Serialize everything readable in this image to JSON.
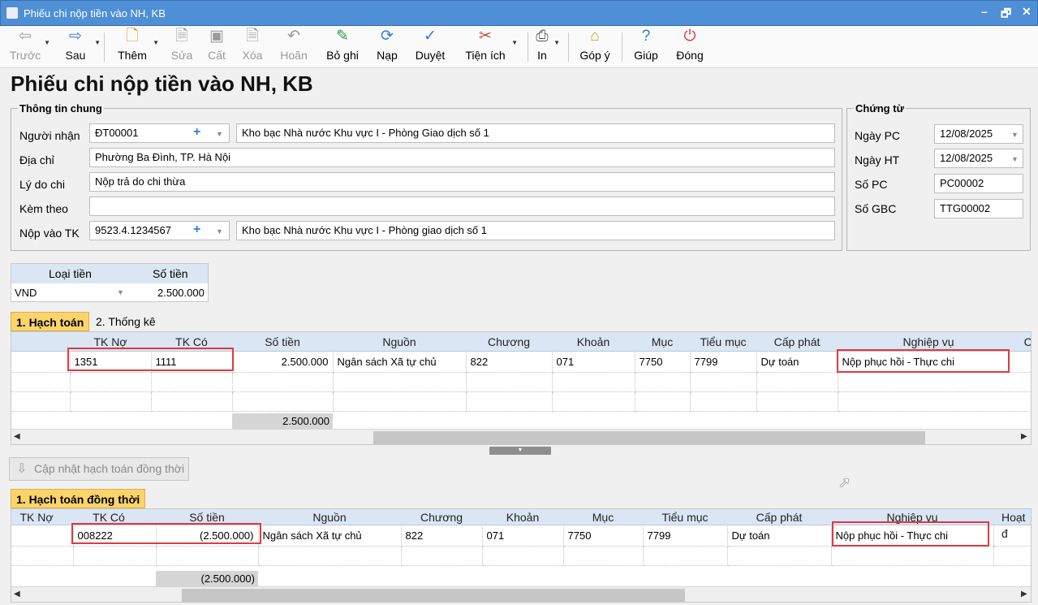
{
  "window": {
    "title": "Phiếu chi nộp tiền vào NH, KB",
    "min": "–",
    "restore": "🗗",
    "close": "✕"
  },
  "toolbar": {
    "prev": "Trước",
    "next": "Sau",
    "add": "Thêm",
    "edit": "Sửa",
    "save": "Cất",
    "delete": "Xóa",
    "undo": "Hoãn",
    "unpost": "Bỏ ghi",
    "reload": "Nạp",
    "approve": "Duyệt",
    "utilities": "Tiện ích",
    "print": "In",
    "feedback": "Góp ý",
    "help": "Giúp",
    "close": "Đóng"
  },
  "page_title": "Phiếu chi nộp tiền vào NH, KB",
  "general": {
    "legend": "Thông tin chung",
    "recipient_label": "Người nhận",
    "recipient_code": "ĐT00001",
    "recipient_name": "Kho bạc Nhà nước Khu vực I - Phòng Giao dịch số 1",
    "address_label": "Địa chỉ",
    "address": "Phường Ba Đình, TP. Hà Nội",
    "reason_label": "Lý do chi",
    "reason": "Nộp trả do chi thừa",
    "attach_label": "Kèm theo",
    "attach": "",
    "account_label": "Nộp vào TK",
    "account_code": "9523.4.1234567",
    "account_name": "Kho bạc Nhà nước Khu vực I - Phòng giao dịch số 1"
  },
  "voucher": {
    "legend": "Chứng từ",
    "date_pc_label": "Ngày PC",
    "date_pc": "12/08/2025",
    "date_ht_label": "Ngày HT",
    "date_ht": "12/08/2025",
    "no_pc_label": "Số PC",
    "no_pc": "PC00002",
    "no_gbc_label": "Số GBC",
    "no_gbc": "TTG00002"
  },
  "currency": {
    "type_header": "Loại tiền",
    "amount_header": "Số tiền",
    "type": "VND",
    "amount": "2.500.000"
  },
  "tabs": {
    "t1": "1. Hạch toán",
    "t2": "2. Thống kê"
  },
  "grid1": {
    "headers": [
      "TK Nợ",
      "TK Có",
      "Số tiền",
      "Nguồn",
      "Chương",
      "Khoản",
      "Mục",
      "Tiểu mục",
      "Cấp phát",
      "Nghiệp vụ",
      "CT"
    ],
    "row": [
      "1351",
      "1111",
      "2.500.000",
      "Ngân sách Xã tự chủ",
      "822",
      "071",
      "7750",
      "7799",
      "Dự toán",
      "Nộp phục hồi - Thực chi"
    ],
    "total": "2.500.000"
  },
  "update_button": "Cập nhật hạch toán đồng thời",
  "tab_concurrent": "1. Hạch toán đồng thời",
  "grid2": {
    "headers": [
      "TK Nợ",
      "TK Có",
      "Số tiền",
      "Nguồn",
      "Chương",
      "Khoản",
      "Mục",
      "Tiểu mục",
      "Cấp phát",
      "Nghiệp vụ",
      "Hoạt đ"
    ],
    "row": [
      "",
      "008222",
      "(2.500.000)",
      "Ngân sách Xã tự chủ",
      "822",
      "071",
      "7750",
      "7799",
      "Dự toán",
      "Nộp phục hồi - Thực chi"
    ],
    "total": "(2.500.000)"
  }
}
